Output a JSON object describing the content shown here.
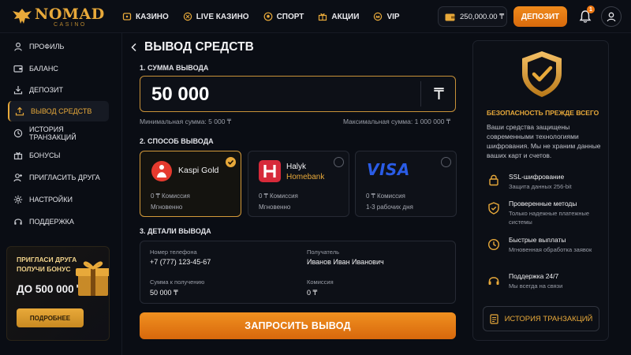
{
  "brand": {
    "name": "NOMAD",
    "sub": "CASINO"
  },
  "nav": [
    {
      "label": "КАЗИНО",
      "icon": "casino-icon"
    },
    {
      "label": "LIVE КАЗИНО",
      "icon": "live-icon"
    },
    {
      "label": "СПОРТ",
      "icon": "soccer-ball-icon"
    },
    {
      "label": "АКЦИИ",
      "icon": "gift-icon"
    },
    {
      "label": "VIP",
      "icon": "crown-icon"
    }
  ],
  "header": {
    "balance": "250,000.00 ₸",
    "deposit_label": "ДЕПОЗИТ",
    "notifications": "1"
  },
  "sidebar": {
    "items": [
      {
        "label": "ПРОФИЛЬ",
        "icon": "user-icon"
      },
      {
        "label": "БАЛАНС",
        "icon": "wallet-icon"
      },
      {
        "label": "ДЕПОЗИТ",
        "icon": "download-icon"
      },
      {
        "label": "ВЫВОД СРЕДСТВ",
        "icon": "upload-icon",
        "active": true
      },
      {
        "label": "ИСТОРИЯ ТРАНЗАКЦИЙ",
        "icon": "history-icon"
      },
      {
        "label": "БОНУСЫ",
        "icon": "gift-icon"
      },
      {
        "label": "ПРИГЛАСИТЬ ДРУГА",
        "icon": "add-user-icon"
      },
      {
        "label": "НАСТРОЙКИ",
        "icon": "gear-icon"
      },
      {
        "label": "ПОДДЕРЖКА",
        "icon": "headset-icon"
      }
    ],
    "promo": {
      "line1": "ПРИГЛАСИ ДРУГА",
      "line2": "ПОЛУЧИ БОНУС",
      "amount": "ДО 500 000 ₸",
      "button": "ПОДРОБНЕЕ"
    }
  },
  "main": {
    "title": "ВЫВОД СРЕДСТВ",
    "amount_section": "1. СУММА ВЫВОДА",
    "amount_value": "50 000",
    "currency_symbol": "₸",
    "min_text": "Минимальная сумма: 5 000 ₸",
    "max_text": "Максимальная сумма: 1 000 000 ₸",
    "method_section": "2. СПОСОБ ВЫВОДА",
    "methods": [
      {
        "name": "Kaspi Gold",
        "name2": "",
        "fee": "0 ₸ Комиссия",
        "time": "Мгновенно",
        "selected": true,
        "color": "#e53a2e"
      },
      {
        "name": "Halyk",
        "name2": "Homebank",
        "fee": "0 ₸ Комиссия",
        "time": "Мгновенно",
        "selected": false,
        "color": "#d72a3a"
      },
      {
        "name": "VISA",
        "name2": "",
        "fee": "0 ₸ Комиссия",
        "time": "1-3 рабочих дня",
        "selected": false,
        "color": "#1a4fd6"
      }
    ],
    "details_section": "3. ДЕТАЛИ ВЫВОДА",
    "details": {
      "phone_label": "Номер телефона",
      "phone": "+7 (777) 123-45-67",
      "recipient_label": "Получатель",
      "recipient": "Иванов Иван Иванович",
      "receive_label": "Сумма к получению",
      "receive": "50 000 ₸",
      "fee_label": "Комиссия",
      "fee": "0 ₸"
    },
    "submit": "ЗАПРОСИТЬ ВЫВОД"
  },
  "security": {
    "title": "БЕЗОПАСНОСТЬ ПРЕЖДЕ ВСЕГО",
    "desc": "Ваши средства защищены современными технологиями шифрования. Мы не храним данные ваших карт и счетов.",
    "features": [
      {
        "title": "SSL-шифрование",
        "sub": "Защита данных 256-bit",
        "icon": "lock-icon"
      },
      {
        "title": "Проверенные методы",
        "sub": "Только надежные платежные системы",
        "icon": "shield-check-icon"
      },
      {
        "title": "Быстрые выплаты",
        "sub": "Мгновенная обработка заявок",
        "icon": "clock-icon"
      },
      {
        "title": "Поддержка 24/7",
        "sub": "Мы всегда на связи",
        "icon": "headset-icon"
      }
    ],
    "history_button": "ИСТОРИЯ ТРАНЗАКЦИЙ"
  },
  "colors": {
    "accent": "#e8a93a",
    "orange": "#f08a1c",
    "bg": "#0a0d14"
  }
}
